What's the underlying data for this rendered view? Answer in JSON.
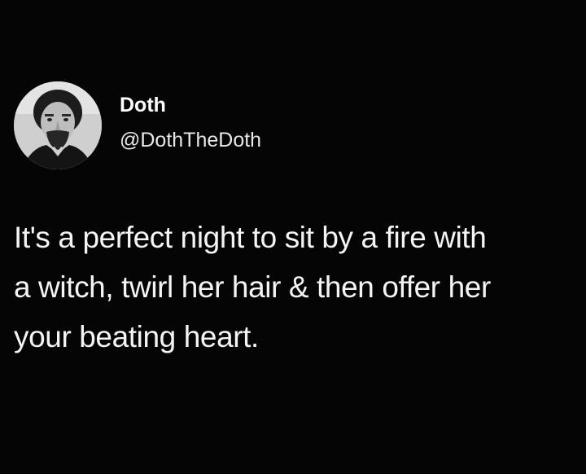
{
  "author": {
    "display_name": "Doth",
    "handle": "@DothTheDoth",
    "avatar_icon": "user-portrait-avatar"
  },
  "tweet": {
    "lines": [
      "It's a perfect night to sit by a fire with",
      "a witch, twirl her hair & then offer her",
      "your beating heart."
    ]
  },
  "colors": {
    "background": "#050505",
    "text": "#f4f4f4"
  }
}
